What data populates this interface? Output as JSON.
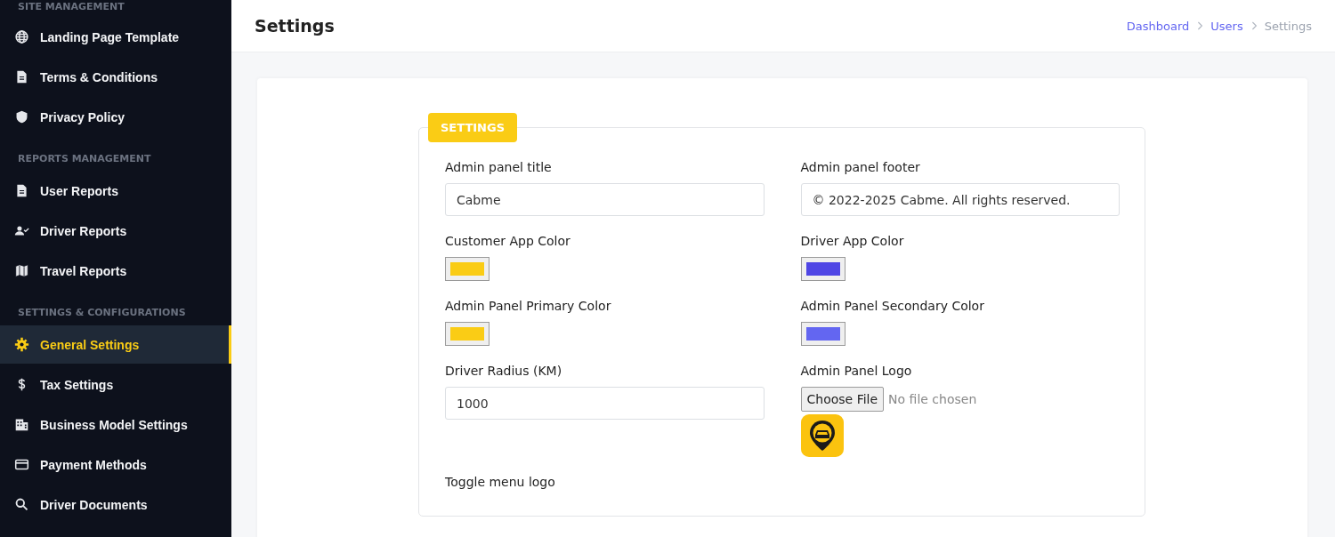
{
  "sidebar": {
    "sections": [
      {
        "heading": "SITE MANAGEMENT",
        "items": [
          {
            "label": "Landing Page Template",
            "selected": false
          },
          {
            "label": "Terms & Conditions",
            "selected": false
          },
          {
            "label": "Privacy Policy",
            "selected": false
          }
        ]
      },
      {
        "heading": "REPORTS MANAGEMENT",
        "items": [
          {
            "label": "User Reports",
            "selected": false
          },
          {
            "label": "Driver Reports",
            "selected": false
          },
          {
            "label": "Travel Reports",
            "selected": false
          }
        ]
      },
      {
        "heading": "SETTINGS & CONFIGURATIONS",
        "items": [
          {
            "label": "General Settings",
            "selected": true
          },
          {
            "label": "Tax Settings",
            "selected": false
          },
          {
            "label": "Business Model Settings",
            "selected": false
          },
          {
            "label": "Payment Methods",
            "selected": false
          },
          {
            "label": "Driver Documents",
            "selected": false
          }
        ]
      }
    ]
  },
  "header": {
    "title": "Settings",
    "breadcrumb": [
      {
        "label": "Dashboard",
        "current": false
      },
      {
        "label": "Users",
        "current": false
      },
      {
        "label": "Settings",
        "current": true
      }
    ]
  },
  "form": {
    "legend": "SETTINGS",
    "fields": [
      {
        "kind": "text",
        "label": "Admin panel title",
        "value": "Cabme"
      },
      {
        "kind": "text",
        "label": "Admin panel footer",
        "value": "© 2022-2025 Cabme. All rights reserved."
      },
      {
        "kind": "color",
        "label": "Customer App Color",
        "color": "#facc15"
      },
      {
        "kind": "color",
        "label": "Driver App Color",
        "color": "#4f46e5"
      },
      {
        "kind": "color",
        "label": "Admin Panel Primary Color",
        "color": "#facc15"
      },
      {
        "kind": "color",
        "label": "Admin Panel Secondary Color",
        "color": "#6366f1"
      },
      {
        "kind": "text",
        "label": "Driver Radius (KM)",
        "value": "1000"
      },
      {
        "kind": "file",
        "label": "Admin Panel Logo",
        "button": "Choose File",
        "status": "No file chosen"
      },
      {
        "kind": "label",
        "label": "Toggle menu logo"
      }
    ]
  }
}
